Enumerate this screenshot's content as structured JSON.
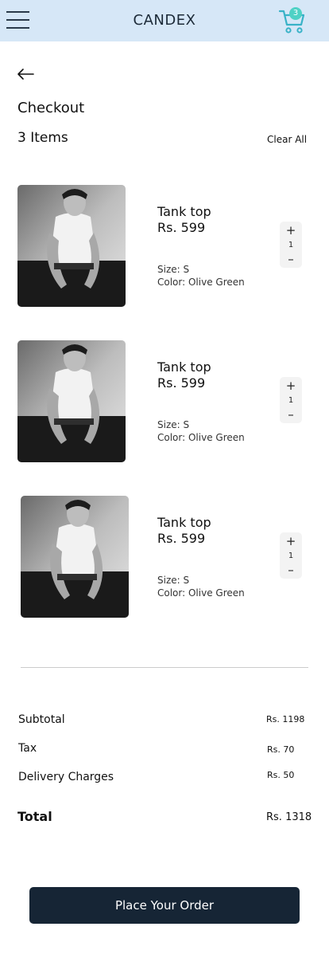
{
  "header": {
    "brand": "CANDEX",
    "menu_icon": "hamburger-menu-icon",
    "cart_icon": "shopping-cart-icon",
    "cart_badge": "3",
    "bg_color": "#d6e7f7",
    "accent_color": "#4fd1c5"
  },
  "nav": {
    "back_icon": "arrow-left-icon"
  },
  "page": {
    "title": "Checkout",
    "item_count": "3 Items",
    "clear_all": "Clear All"
  },
  "items": [
    {
      "name": "Tank top",
      "price": "Rs. 599",
      "size": "Size: S",
      "color": "Color: Olive Green",
      "quantity": "1",
      "plus": "+",
      "minus": "–"
    },
    {
      "name": "Tank top",
      "price": "Rs. 599",
      "size": "Size: S",
      "color": "Color: Olive Green",
      "quantity": "1",
      "plus": "+",
      "minus": "–"
    },
    {
      "name": "Tank top",
      "price": "Rs. 599",
      "size": "Size: S",
      "color": "Color: Olive Green",
      "quantity": "1",
      "plus": "+",
      "minus": "–"
    }
  ],
  "summary": {
    "subtotal_label": "Subtotal",
    "subtotal_value": "Rs. 1198",
    "tax_label": "Tax",
    "tax_value": "Rs. 70",
    "delivery_label": "Delivery Charges",
    "delivery_value": "Rs. 50",
    "total_label": "Total",
    "total_value": "Rs. 1318"
  },
  "actions": {
    "place_order": "Place Your Order",
    "button_color": "#162535"
  }
}
